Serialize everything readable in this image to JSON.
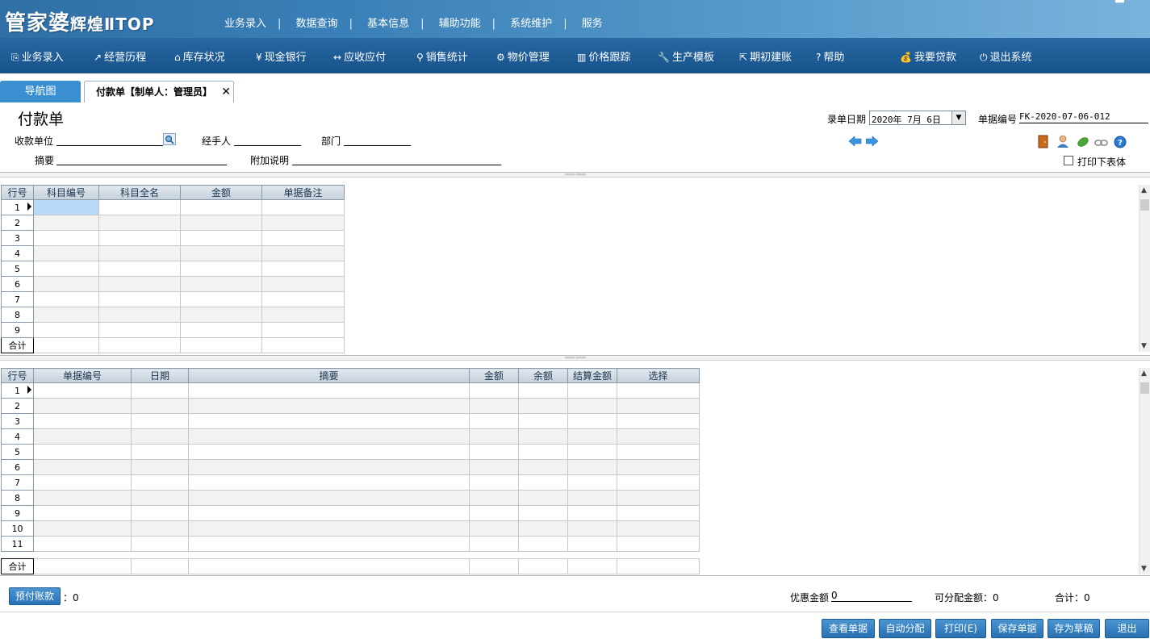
{
  "header": {
    "logo_main": "管家婆",
    "logo_sub": "辉煌ⅡTOP",
    "menu": [
      "业务录入",
      "数据查询",
      "基本信息",
      "辅助功能",
      "系统维护",
      "服务"
    ],
    "separator": "|",
    "close_glyph": "▀"
  },
  "toolbar": {
    "items": [
      {
        "icon": "ledger-icon",
        "glyph": "⎘",
        "label": "业务录入"
      },
      {
        "icon": "chart-line-icon",
        "glyph": "↗",
        "label": "经营历程"
      },
      {
        "icon": "home-icon",
        "glyph": "⌂",
        "label": "库存状况"
      },
      {
        "icon": "yen-icon",
        "glyph": "¥",
        "label": "现金银行"
      },
      {
        "icon": "exchange-icon",
        "glyph": "↔",
        "label": "应收应付"
      },
      {
        "icon": "search-icon",
        "glyph": "⚲",
        "label": "销售统计"
      },
      {
        "icon": "gear-icon",
        "glyph": "⚙",
        "label": "物价管理"
      },
      {
        "icon": "bar-chart-icon",
        "glyph": "▥",
        "label": "价格跟踪"
      },
      {
        "icon": "wrench-icon",
        "glyph": "🔧",
        "label": "生产模板"
      },
      {
        "icon": "external-icon",
        "glyph": "⇱",
        "label": "期初建账"
      },
      {
        "icon": "question-icon",
        "glyph": "?",
        "label": "帮助"
      },
      {
        "icon": "money-bag-icon",
        "glyph": "💰",
        "label": "我要贷款"
      },
      {
        "icon": "power-icon",
        "glyph": "⏻",
        "label": "退出系统"
      }
    ]
  },
  "tabs": {
    "nav_label": "导航图",
    "active_label": "付款单【制单人：管理员】",
    "close_glyph": "✕"
  },
  "form": {
    "title": "付款单",
    "payee_label": "收款单位",
    "handler_label": "经手人",
    "dept_label": "部门",
    "summary_label": "摘要",
    "note_label": "附加说明",
    "date_label": "录单日期",
    "date_value": "2020年 7月 6日",
    "docno_label": "单据编号",
    "docno_value": "FK-2020-07-06-012",
    "print_lower_label": "打印下表体",
    "splitter_text": "›››››››››   ›››››››››"
  },
  "grid1": {
    "columns": [
      "行号",
      "科目编号",
      "科目全名",
      "金额",
      "单据备注"
    ],
    "rows": [
      "1",
      "2",
      "3",
      "4",
      "5",
      "6",
      "7",
      "8",
      "9"
    ],
    "total_label": "合计"
  },
  "grid2": {
    "columns": [
      "行号",
      "单据编号",
      "日期",
      "摘要",
      "金额",
      "余额",
      "结算金额",
      "选择"
    ],
    "rows": [
      "1",
      "2",
      "3",
      "4",
      "5",
      "6",
      "7",
      "8",
      "9",
      "10",
      "11"
    ],
    "total_label": "合计"
  },
  "footer": {
    "prepay_label": "预付账款",
    "prepay_value": "：0",
    "discount_label": "优惠金额",
    "discount_value": "0",
    "allocatable_label": "可分配金额：",
    "allocatable_value": "0",
    "total_label": "合计：",
    "total_value": "0",
    "buttons": [
      "查看单据",
      "自动分配",
      "打印(E)",
      "保存单据",
      "存为草稿",
      "退出"
    ]
  },
  "colors": {
    "header_blue": "#2f6fa5",
    "toolbar_blue": "#1e5d96",
    "button_blue": "#2871b5",
    "selected_cell": "#b8d8f8"
  }
}
